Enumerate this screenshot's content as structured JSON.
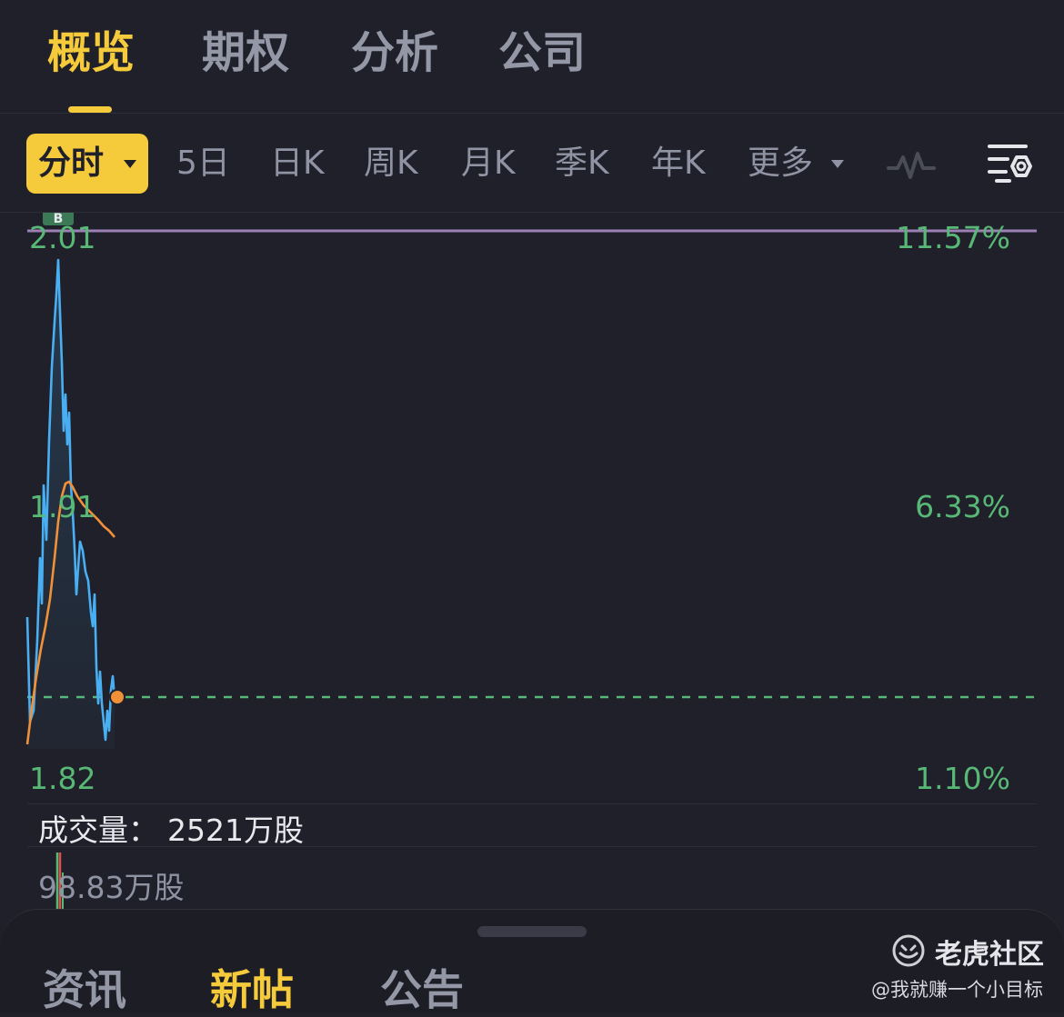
{
  "top_tabs": [
    {
      "label": "概览",
      "active": true
    },
    {
      "label": "期权",
      "active": false
    },
    {
      "label": "分析",
      "active": false
    },
    {
      "label": "公司",
      "active": false
    }
  ],
  "period_bar": {
    "selected": "分时",
    "options": [
      "5日",
      "日K",
      "周K",
      "月K",
      "季K",
      "年K"
    ],
    "more": "更多",
    "icons": [
      "indicator-wave-icon",
      "chart-settings-icon"
    ]
  },
  "chart": {
    "price_high": "2.01",
    "price_mid": "1.91",
    "price_low": "1.82",
    "pct_high": "11.57%",
    "pct_mid": "6.33%",
    "pct_low": "1.10%",
    "marker_badge": "B",
    "colors": {
      "price_line": "#4aaef2",
      "avg_line": "#f0913a",
      "grid_green": "#58b876",
      "high_line": "#9b7fb5"
    }
  },
  "volume": {
    "title": "成交量：",
    "total": "2521万股",
    "max": "98.83万股"
  },
  "bottom_sheet": {
    "tabs": [
      {
        "label": "资讯",
        "active": false
      },
      {
        "label": "新帖",
        "active": true
      },
      {
        "label": "公告",
        "active": false
      }
    ]
  },
  "watermark": {
    "name": "老虎社区",
    "user": "@我就赚一个小目标"
  }
}
